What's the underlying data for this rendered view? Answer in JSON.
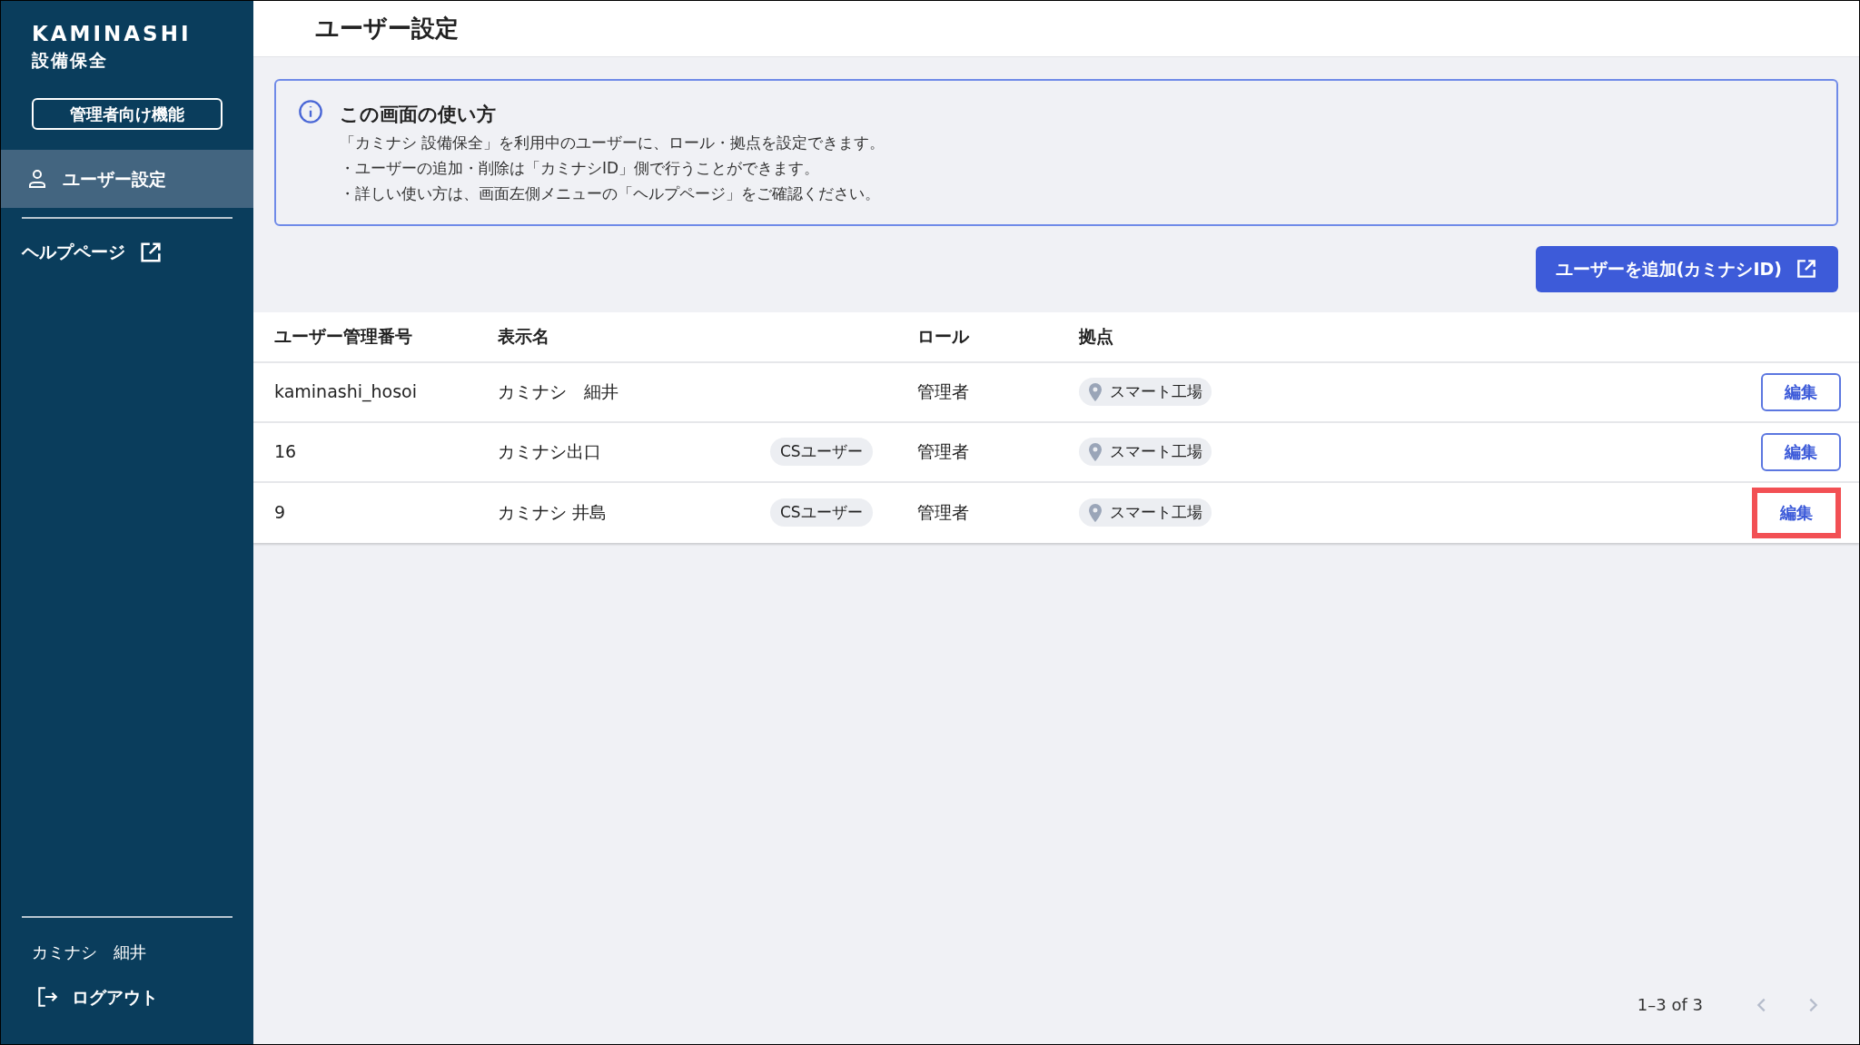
{
  "sidebar": {
    "logo": "KAMINASHI",
    "product": "設備保全",
    "admin_badge": "管理者向け機能",
    "items": [
      {
        "label": "ユーザー設定",
        "selected": true
      }
    ],
    "help_link": "ヘルプページ",
    "user_name": "カミナシ　細井",
    "logout": "ログアウト"
  },
  "page_title": "ユーザー設定",
  "info": {
    "title": "この画面の使い方",
    "lines": [
      "「カミナシ 設備保全」を利用中のユーザーに、ロール・拠点を設定できます。",
      "・ユーザーの追加・削除は「カミナシID」側で行うことができます。",
      "・詳しい使い方は、画面左側メニューの「ヘルプページ」をご確認ください。"
    ]
  },
  "add_button": "ユーザーを追加(カミナシID)",
  "table": {
    "columns": [
      "ユーザー管理番号",
      "表示名",
      "ロール",
      "拠点"
    ],
    "rows": [
      {
        "id": "kaminashi_hosoi",
        "name": "カミナシ　細井",
        "role": "管理者",
        "location": "スマート工場",
        "edit": "編集",
        "highlighted": false
      },
      {
        "id": "16",
        "name": "カミナシ出口",
        "badge": "CSユーザー",
        "role": "管理者",
        "location": "スマート工場",
        "edit": "編集",
        "highlighted": false
      },
      {
        "id": "9",
        "name": "カミナシ 井島",
        "badge": "CSユーザー",
        "role": "管理者",
        "location": "スマート工場",
        "edit": "編集",
        "highlighted": true
      }
    ]
  },
  "pagination": {
    "range": "1–3 of 3",
    "prev_disabled": true,
    "next_disabled": true
  }
}
